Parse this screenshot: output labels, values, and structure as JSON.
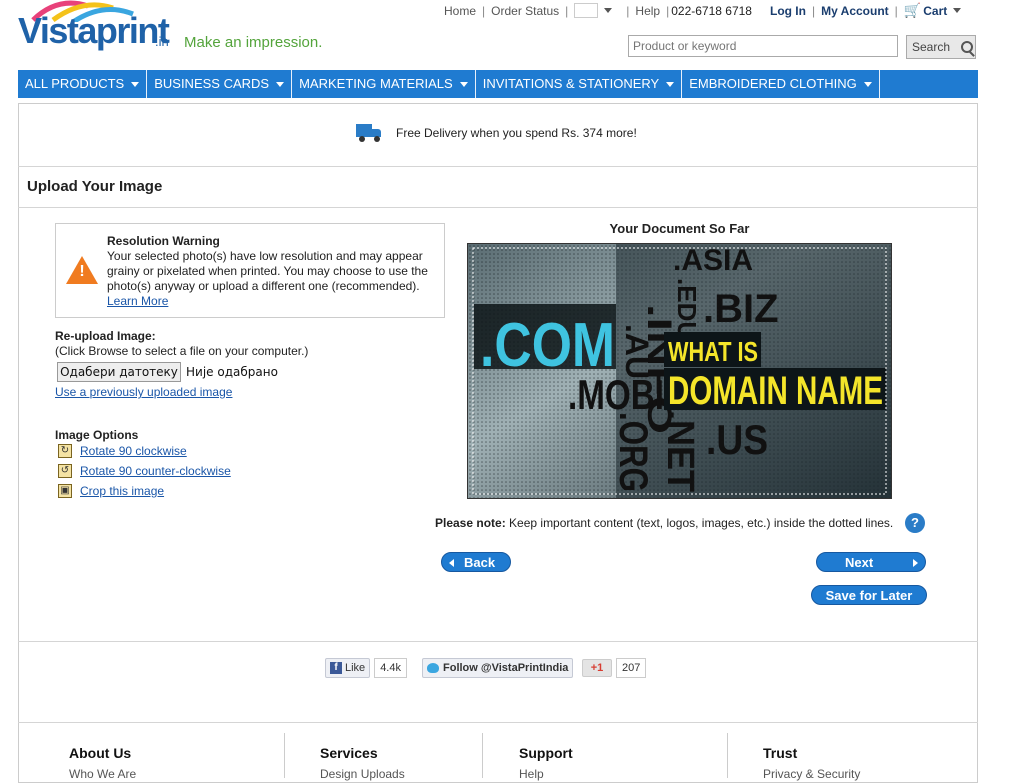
{
  "brand": {
    "logo": "Vistaprint",
    "logo_suffix": ".in",
    "tagline": "Make an impression."
  },
  "toplinks": {
    "home": "Home",
    "order_status": "Order Status",
    "help": "Help",
    "phone": "022-6718 6718",
    "login": "Log In",
    "account": "My Account",
    "cart": "Cart"
  },
  "search": {
    "placeholder": "Product or keyword",
    "button": "Search"
  },
  "nav": [
    {
      "label": "ALL PRODUCTS"
    },
    {
      "label": "BUSINESS CARDS"
    },
    {
      "label": "MARKETING MATERIALS"
    },
    {
      "label": "INVITATIONS & STATIONERY"
    },
    {
      "label": "EMBROIDERED CLOTHING"
    }
  ],
  "delivery": {
    "text": "Free Delivery when you spend Rs. 374 more!"
  },
  "page": {
    "title": "Upload Your Image"
  },
  "warning": {
    "title": "Resolution Warning",
    "body": "Your selected photo(s) have low resolution and may appear grainy or pixelated when printed. You may choose to use the photo(s) anyway or upload a different one (recommended).",
    "link": "Learn More"
  },
  "reupload": {
    "label": "Re-upload Image:",
    "hint": "(Click Browse to select a file on your computer.)",
    "browse": "Одабери датотеку",
    "status": "Није одабрано",
    "previous_link": "Use a previously uploaded image"
  },
  "options": {
    "title": "Image Options",
    "items": [
      {
        "label": "Rotate 90 clockwise"
      },
      {
        "label": "Rotate 90 counter-clockwise"
      },
      {
        "label": "Crop this image"
      }
    ]
  },
  "document": {
    "title": "Your Document So Far",
    "image_text": {
      "com": ".COM",
      "au": ".AU",
      "info": ".INFO",
      "asia": ".ASIA",
      "edu": ".EDU",
      "biz": ".BIZ",
      "what_is": "WHAT IS",
      "domain_name": "DOMAIN NAME",
      "mobi": ".MOBI",
      "org": ".ORG",
      "net": ".NET",
      "us": ".US"
    }
  },
  "note": {
    "bold": "Please note:",
    "text": " Keep important content (text, logos, images, etc.) inside the dotted lines.",
    "help": "?"
  },
  "buttons": {
    "back": "Back",
    "next": "Next",
    "save": "Save for Later"
  },
  "social": {
    "fb_label": "Like",
    "fb_icon": "f",
    "fb_count": "4.4k",
    "twitter_label": "Follow @VistaPrintIndia",
    "gplus_label": "+1",
    "gplus_count": "207"
  },
  "footer": {
    "columns": [
      {
        "title": "About Us",
        "sub": "Who We Are"
      },
      {
        "title": "Services",
        "sub": "Design Uploads"
      },
      {
        "title": "Support",
        "sub": "Help"
      },
      {
        "title": "Trust",
        "sub": "Privacy & Security"
      }
    ]
  },
  "colors": {
    "nav_blue": "#1f7bd1",
    "brand_green": "#54a43c",
    "warning_orange": "#f07b20",
    "highlight_yellow": "#f4e52a",
    "cyan": "#3fc3e0"
  }
}
